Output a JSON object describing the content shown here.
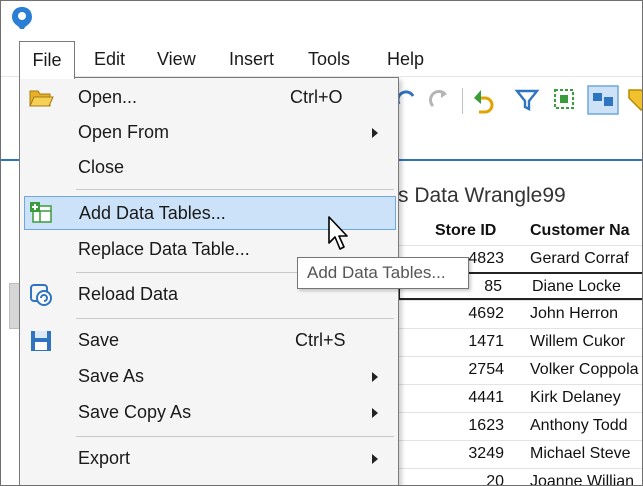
{
  "menubar": {
    "file": "File",
    "edit": "Edit",
    "view": "View",
    "insert": "Insert",
    "tools": "Tools",
    "help": "Help"
  },
  "file_menu": {
    "items": [
      {
        "label": "Open...",
        "shortcut": "Ctrl+O",
        "icon": "open-folder-icon"
      },
      {
        "label": "Open From",
        "submenu": true
      },
      {
        "label": "Close"
      },
      {
        "label": "Add Data Tables...",
        "icon": "add-table-icon",
        "highlighted": true
      },
      {
        "label": "Replace Data Table..."
      },
      {
        "label": "Reload Data",
        "icon": "reload-data-icon"
      },
      {
        "label": "Save",
        "shortcut": "Ctrl+S",
        "icon": "save-disk-icon"
      },
      {
        "label": "Save As",
        "submenu": true
      },
      {
        "label": "Save Copy As",
        "submenu": true
      },
      {
        "label": "Export",
        "submenu": true
      }
    ]
  },
  "tooltip": "Add Data Tables...",
  "table": {
    "title": "s Data Wrangle99",
    "columns": [
      "Store ID",
      "Customer Na"
    ],
    "rows": [
      {
        "store_id": "4823",
        "customer": "Gerard Corraf"
      },
      {
        "store_id": "85",
        "customer": "Diane Locke"
      },
      {
        "store_id": "4692",
        "customer": "John Herron"
      },
      {
        "store_id": "1471",
        "customer": "Willem Cukor"
      },
      {
        "store_id": "2754",
        "customer": "Volker Coppola"
      },
      {
        "store_id": "4441",
        "customer": "Kirk Delaney"
      },
      {
        "store_id": "1623",
        "customer": "Anthony Todd"
      },
      {
        "store_id": "3249",
        "customer": "Michael Steve"
      },
      {
        "store_id": "20",
        "customer": "Joanne Willian"
      }
    ]
  },
  "colors": {
    "accent": "#2f74c0",
    "highlight_bg": "#cce2f8",
    "highlight_border": "#6fa8dc",
    "menu_bg": "#f5f5f5"
  },
  "toolbar": {
    "icons": [
      "redo-icon",
      "undo-icon",
      "filter-icon",
      "marking-icon",
      "details-panel-icon",
      "tag-icon"
    ]
  }
}
